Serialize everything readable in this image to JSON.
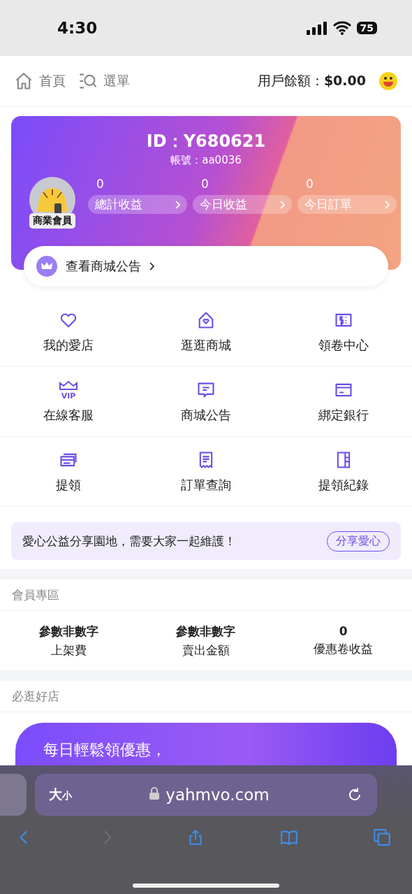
{
  "status_bar": {
    "time": "4:30",
    "battery": "75"
  },
  "header": {
    "nav": [
      {
        "label": "首頁"
      },
      {
        "label": "選單"
      }
    ],
    "balance_label": "用戶餘額：",
    "balance": "$0.00"
  },
  "profile": {
    "id": "ID：Y680621",
    "account": "帳號：aa0036",
    "badge": "商業會員",
    "stats": [
      {
        "value": "0",
        "label": "總計收益"
      },
      {
        "value": "0",
        "label": "今日收益"
      },
      {
        "value": "0",
        "label": "今日訂單"
      }
    ],
    "notice": "查看商城公告"
  },
  "grid": [
    {
      "label": "我的愛店"
    },
    {
      "label": "逛逛商城"
    },
    {
      "label": "領卷中心"
    },
    {
      "label": "在線客服",
      "icon_text": "VIP"
    },
    {
      "label": "商城公告"
    },
    {
      "label": "綁定銀行"
    },
    {
      "label": "提領"
    },
    {
      "label": "訂單查詢"
    },
    {
      "label": "提領紀錄"
    }
  ],
  "share": {
    "text": "愛心公益分享園地，需要大家一起維護！",
    "button": "分享愛心"
  },
  "member": {
    "title": "會員專區",
    "stats": [
      {
        "value": "參數非數字",
        "label": "上架費"
      },
      {
        "value": "參數非數字",
        "label": "賣出金額"
      },
      {
        "value": "0",
        "label": "優惠卷收益"
      }
    ]
  },
  "shops": {
    "title": "必逛好店",
    "promo": "每日輕鬆領優惠，"
  },
  "browser": {
    "text_size": {
      "large": "大",
      "small": "小"
    },
    "url": "yahmvo.com",
    "buttons": [
      {
        "disabled": false
      },
      {
        "disabled": true
      },
      {
        "disabled": false
      },
      {
        "disabled": false
      },
      {
        "disabled": false
      }
    ]
  }
}
